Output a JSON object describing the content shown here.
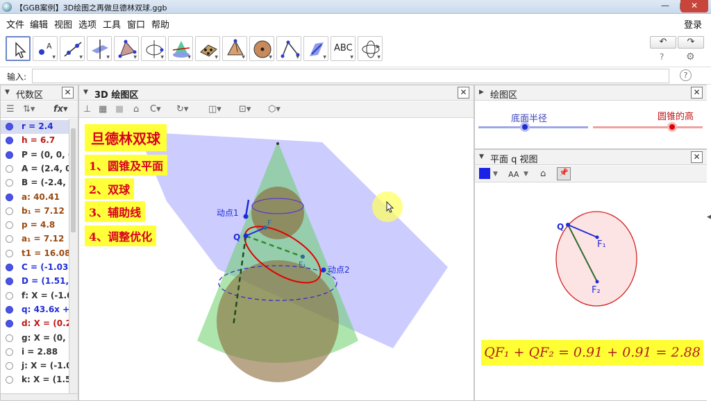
{
  "window": {
    "title": "【GGB案例】3D绘图之再做旦德林双球.ggb",
    "minimize": "—",
    "maximize": "□",
    "close": "✕"
  },
  "menu": {
    "items": [
      "文件",
      "编辑",
      "视图",
      "选项",
      "工具",
      "窗口",
      "帮助"
    ],
    "login": "登录"
  },
  "toolbar": {
    "tools": [
      "move-tool",
      "point-tool",
      "line-tool",
      "perpendicular-tool",
      "polygon-tool",
      "circle-axis-tool",
      "intersect-surfaces-tool",
      "pyramid-tool",
      "cone-tool",
      "sphere-tool",
      "angle-tool",
      "reflect-tool",
      "text-tool",
      "rotate-view-tool"
    ],
    "text_tool_label": "ABC",
    "undo": "↶",
    "redo": "↷",
    "help": "?",
    "settings": "⚙"
  },
  "input": {
    "label": "输入:",
    "value": "",
    "help": "?"
  },
  "algebra": {
    "title": "代数区",
    "rows": [
      {
        "text": "r = 2.4",
        "color": "#1f2bd6",
        "on": true,
        "bg": true
      },
      {
        "text": "h = 6.7",
        "color": "#c01616",
        "on": true
      },
      {
        "text": "P = (0, 0, 6",
        "color": "#333333",
        "on": true
      },
      {
        "text": "A = (2.4, 0",
        "color": "#333333",
        "on": false
      },
      {
        "text": "B = (-2.4, (",
        "color": "#333333",
        "on": false
      },
      {
        "text": "a: 40.41",
        "color": "#9a4a10",
        "on": true
      },
      {
        "text": "b₁ = 7.12",
        "color": "#9a4a10",
        "on": false
      },
      {
        "text": "p = 4.8",
        "color": "#9a4a10",
        "on": false
      },
      {
        "text": "a₁ = 7.12",
        "color": "#9a4a10",
        "on": false
      },
      {
        "text": "t1 = 16.08",
        "color": "#9a4a10",
        "on": false
      },
      {
        "text": "C = (-1.03,",
        "color": "#1f2bd6",
        "on": true
      },
      {
        "text": "D = (1.51,",
        "color": "#1f2bd6",
        "on": true
      },
      {
        "text": "f: X = (-1.0",
        "color": "#333333",
        "on": false
      },
      {
        "text": "q: 43.6x +",
        "color": "#1f2bd6",
        "on": true
      },
      {
        "text": "d: X = (0.2",
        "color": "#c01616",
        "on": true
      },
      {
        "text": "g: X = (0, (",
        "color": "#333333",
        "on": false
      },
      {
        "text": "i = 2.88",
        "color": "#333333",
        "on": false
      },
      {
        "text": "j: X = (-1.0",
        "color": "#333333",
        "on": false
      },
      {
        "text": "k: X = (1.5",
        "color": "#333333",
        "on": false
      }
    ]
  },
  "view3d": {
    "title": "3D 绘图区",
    "heading": "旦德林双球",
    "steps": [
      "1、圆锥及平面",
      "2、双球",
      "3、辅助线",
      "4、调整优化"
    ],
    "labels": {
      "p1": "动点1",
      "p2": "动点2",
      "q": "Q",
      "f": "F",
      "f1": "F₁"
    }
  },
  "graphics": {
    "title": "绘图区",
    "slider1": {
      "label": "底面半径",
      "value": 0.44
    },
    "slider2": {
      "label": "圆锥的高",
      "value": 0.74
    }
  },
  "planeview": {
    "title": "平面 q 视图",
    "aa": "AA",
    "labels": {
      "q": "Q",
      "f1": "F₁",
      "f2": "F₂"
    },
    "formula": "QF₁ + QF₂ = 0.91 + 0.91 = 2.88"
  },
  "colors": {
    "blue": "#1f2bd6",
    "red": "#e00000",
    "green": "#2d8a2d",
    "yellow": "#ffff33",
    "accent": "#6a86c8"
  }
}
